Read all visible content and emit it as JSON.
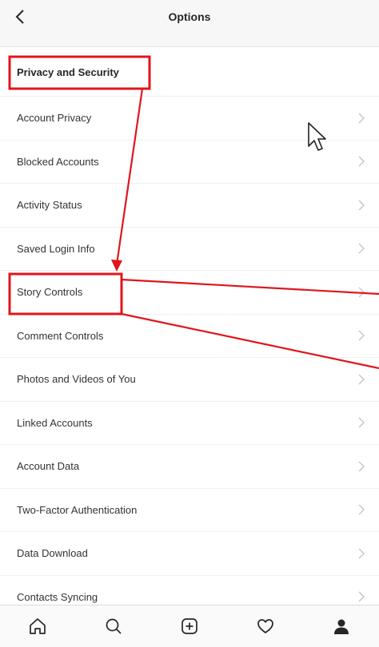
{
  "header": {
    "title": "Options"
  },
  "section": {
    "title": "Privacy and Security"
  },
  "items": [
    {
      "label": "Account Privacy"
    },
    {
      "label": "Blocked Accounts"
    },
    {
      "label": "Activity Status"
    },
    {
      "label": "Saved Login Info"
    },
    {
      "label": "Story Controls"
    },
    {
      "label": "Comment Controls"
    },
    {
      "label": "Photos and Videos of You"
    },
    {
      "label": "Linked Accounts"
    },
    {
      "label": "Account Data"
    },
    {
      "label": "Two-Factor Authentication"
    },
    {
      "label": "Data Download"
    },
    {
      "label": "Contacts Syncing"
    }
  ],
  "tabbar": [
    "home-icon",
    "search-icon",
    "new-post-icon",
    "activity-heart-icon",
    "profile-icon"
  ],
  "annotation_color": "#e0161b"
}
